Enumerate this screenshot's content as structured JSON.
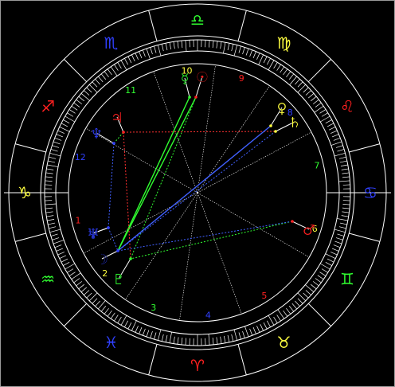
{
  "colors": {
    "background": "#000000",
    "circle": "#ffffff",
    "fire": "#ff2020",
    "earth": "#ffff40",
    "air": "#30ff30",
    "water": "#3040ff",
    "aspect_red": "#ff3030",
    "aspect_green": "#30ff30",
    "aspect_blue": "#4060ff",
    "house_line": "#ffffff"
  },
  "zodiac": [
    {
      "name": "aries",
      "glyph": "♈",
      "color": "#ff2020"
    },
    {
      "name": "taurus",
      "glyph": "♉",
      "color": "#ffff40"
    },
    {
      "name": "gemini",
      "glyph": "♊",
      "color": "#30ff30"
    },
    {
      "name": "cancer",
      "glyph": "♋",
      "color": "#3040ff"
    },
    {
      "name": "leo",
      "glyph": "♌",
      "color": "#ff2020"
    },
    {
      "name": "virgo",
      "glyph": "♍",
      "color": "#ffff40"
    },
    {
      "name": "libra",
      "glyph": "♎",
      "color": "#30ff30"
    },
    {
      "name": "scorpio",
      "glyph": "♏",
      "color": "#3040ff"
    },
    {
      "name": "sagittarius",
      "glyph": "♐",
      "color": "#ff2020"
    },
    {
      "name": "capricorn",
      "glyph": "♑",
      "color": "#ffff40"
    },
    {
      "name": "aquarius",
      "glyph": "♒",
      "color": "#30ff30"
    },
    {
      "name": "pisces",
      "glyph": "♓",
      "color": "#3040ff"
    }
  ],
  "houses": [
    {
      "number": "1",
      "color": "#ff2020"
    },
    {
      "number": "2",
      "color": "#ffff40"
    },
    {
      "number": "3",
      "color": "#30ff30"
    },
    {
      "number": "4",
      "color": "#3040ff"
    },
    {
      "number": "5",
      "color": "#ff2020"
    },
    {
      "number": "6",
      "color": "#ffff40"
    },
    {
      "number": "7",
      "color": "#30ff30"
    },
    {
      "number": "8",
      "color": "#3040ff"
    },
    {
      "number": "9",
      "color": "#ff2020"
    },
    {
      "number": "10",
      "color": "#ffff40"
    },
    {
      "number": "11",
      "color": "#30ff30"
    },
    {
      "number": "12",
      "color": "#3040ff"
    }
  ],
  "planets": [
    {
      "name": "mercury",
      "glyph": "☿",
      "color": "#30ff30"
    },
    {
      "name": "sun",
      "glyph": "☉",
      "color": "#ff2020"
    },
    {
      "name": "venus",
      "glyph": "♀",
      "color": "#ffff40"
    },
    {
      "name": "saturn",
      "glyph": "♄",
      "color": "#ffff40"
    },
    {
      "name": "jupiter",
      "glyph": "♃",
      "color": "#ff2020"
    },
    {
      "name": "neptune",
      "glyph": "♆",
      "color": "#3040ff"
    },
    {
      "name": "mars",
      "glyph": "♂",
      "color": "#ff2020"
    },
    {
      "name": "uranus",
      "glyph": "♅",
      "color": "#3040ff"
    },
    {
      "name": "moon",
      "glyph": "☽",
      "color": "#3040ff"
    },
    {
      "name": "pluto",
      "glyph": "♇",
      "color": "#30ff30"
    },
    {
      "name": "neptune-2",
      "glyph": "♆",
      "color": "#3040ff"
    }
  ],
  "aspects": [
    {
      "from": "mercury",
      "to": "moon",
      "color": "#30ff30",
      "style": "solid"
    },
    {
      "from": "sun",
      "to": "moon",
      "color": "#30ff30",
      "style": "solid"
    },
    {
      "from": "sun",
      "to": "pluto",
      "color": "#30ff30",
      "style": "dotted"
    },
    {
      "from": "jupiter",
      "to": "saturn",
      "color": "#ff3030",
      "style": "dotted"
    },
    {
      "from": "jupiter",
      "to": "pluto",
      "color": "#ff3030",
      "style": "dotted"
    },
    {
      "from": "neptune",
      "to": "jupiter",
      "color": "#30ff30",
      "style": "dotted"
    },
    {
      "from": "venus",
      "to": "moon",
      "color": "#4060ff",
      "style": "solid"
    },
    {
      "from": "saturn",
      "to": "moon",
      "color": "#4060ff",
      "style": "dotted"
    },
    {
      "from": "mars",
      "to": "pluto",
      "color": "#30ff30",
      "style": "dotted"
    },
    {
      "from": "mars",
      "to": "moon",
      "color": "#4060ff",
      "style": "dotted"
    },
    {
      "from": "neptune",
      "to": "neptune-2",
      "color": "#4060ff",
      "style": "dotted"
    },
    {
      "from": "neptune-2",
      "to": "moon",
      "color": "#4060ff",
      "style": "dotted"
    }
  ]
}
